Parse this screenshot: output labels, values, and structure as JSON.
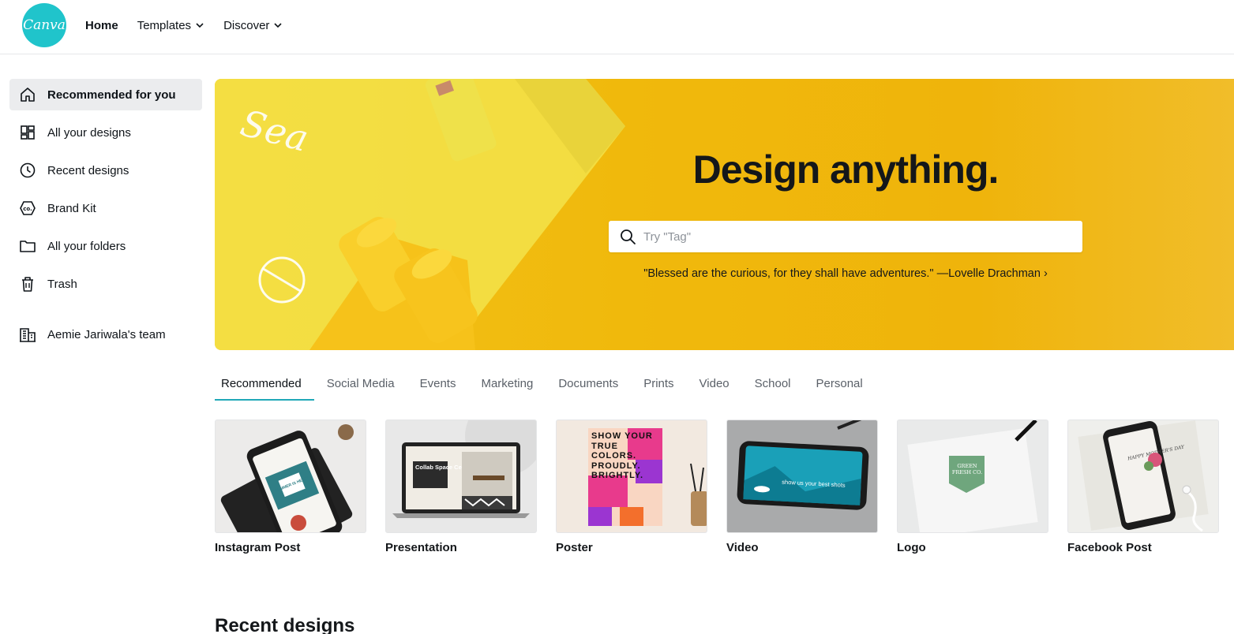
{
  "brand": {
    "logo_text": "Canva",
    "accent": "#20c4cb"
  },
  "topnav": {
    "home": "Home",
    "templates": "Templates",
    "discover": "Discover"
  },
  "sidebar": {
    "items": [
      {
        "label": "Recommended for you",
        "icon": "home-icon"
      },
      {
        "label": "All your designs",
        "icon": "grid-icon"
      },
      {
        "label": "Recent designs",
        "icon": "clock-icon"
      },
      {
        "label": "Brand Kit",
        "icon": "brand-kit-icon"
      },
      {
        "label": "All your folders",
        "icon": "folder-icon"
      },
      {
        "label": "Trash",
        "icon": "trash-icon"
      }
    ],
    "team": {
      "label": "Aemie Jariwala's team",
      "icon": "building-icon"
    }
  },
  "hero": {
    "title": "Design anything.",
    "search_placeholder": "Try \"Tag\"",
    "quote": "\"Blessed are the curious, for they shall have adventures.\" —Lovelle Drachman ›",
    "background": "#f0b90c"
  },
  "tabs": [
    "Recommended",
    "Social Media",
    "Events",
    "Marketing",
    "Documents",
    "Prints",
    "Video",
    "School",
    "Personal"
  ],
  "cards": {
    "instagram": {
      "label": "Instagram Post",
      "overlay": "SUMMER IS HERE!"
    },
    "presentation": {
      "label": "Presentation",
      "overlay": "Collab Space Central"
    },
    "poster": {
      "label": "Poster",
      "overlay": "SHOW YOUR TRUE COLORS. PROUDLY. BRIGHTLY."
    },
    "video": {
      "label": "Video",
      "overlay": "show us your best shots"
    },
    "logo": {
      "label": "Logo",
      "overlay": "GREEN FRESH CO."
    },
    "facebook": {
      "label": "Facebook Post",
      "overlay": "HAPPY MOTHER'S DAY"
    }
  },
  "recent": {
    "title": "Recent designs"
  }
}
